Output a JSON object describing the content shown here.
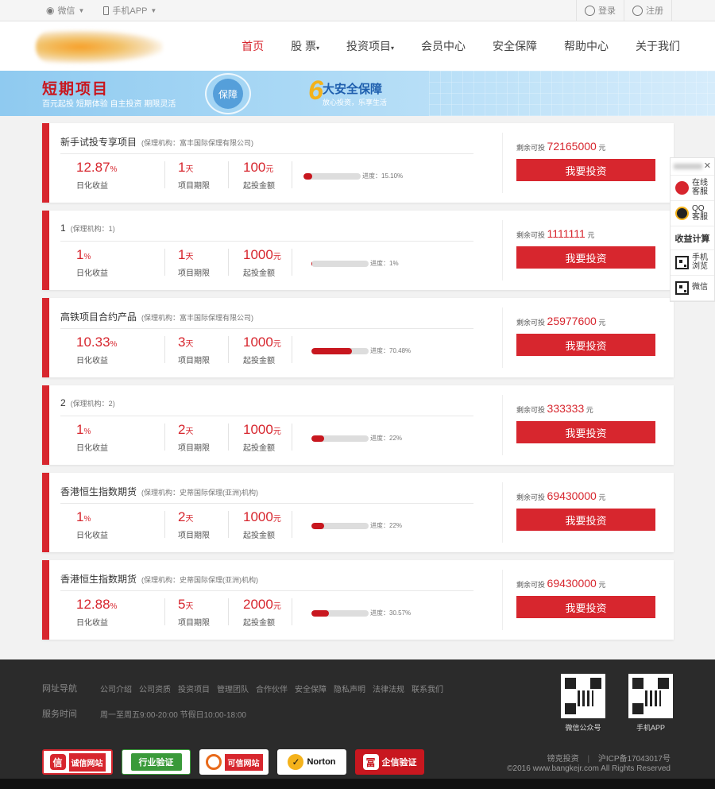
{
  "topbar": {
    "wechat_label": "微信",
    "app_label": "手机APP",
    "login_label": "登录",
    "register_label": "注册"
  },
  "nav": {
    "items": [
      "首页",
      "股 票",
      "投资项目",
      "会员中心",
      "安全保障",
      "帮助中心",
      "关于我们"
    ]
  },
  "banner": {
    "title": "短期项目",
    "subtitle": "百元起投 短期体验 自主投资 期限灵活",
    "shield_label": "保障",
    "six": "6",
    "six_title": "大安全保障",
    "six_sub": "放心投资，乐享生活"
  },
  "labels": {
    "rate": "日化收益",
    "term": "项目期限",
    "min": "起投金额",
    "remain": "剩余可投",
    "yuan": "元",
    "button": "我要投资"
  },
  "products": [
    {
      "name": "新手试投专享项目",
      "org": "(保理机构：富丰国际保理有限公司)",
      "rate": "12.87",
      "rate_unit": "%",
      "term": "1",
      "term_unit": "天",
      "min": "100",
      "min_unit": "元",
      "progress_text": "进度：15.10%",
      "progress": 15.1,
      "remain": "72165000"
    },
    {
      "name": "1",
      "org": "(保理机构：1)",
      "rate": "1",
      "rate_unit": "%",
      "term": "1",
      "term_unit": "天",
      "min": "1000",
      "min_unit": "元",
      "progress_text": "进度：1%",
      "progress": 1,
      "remain": "1111111"
    },
    {
      "name": "高铁项目合约产品",
      "org": "(保理机构：富丰国际保理有限公司)",
      "rate": "10.33",
      "rate_unit": "%",
      "term": "3",
      "term_unit": "天",
      "min": "1000",
      "min_unit": "元",
      "progress_text": "进度：70.48%",
      "progress": 70.48,
      "remain": "25977600"
    },
    {
      "name": "2",
      "org": "(保理机构：2)",
      "rate": "1",
      "rate_unit": "%",
      "term": "2",
      "term_unit": "天",
      "min": "1000",
      "min_unit": "元",
      "progress_text": "进度：22%",
      "progress": 22,
      "remain": "333333"
    },
    {
      "name": "香港恒生指数期货",
      "org": "(保理机构：史蒂国际保理(亚洲)机构)",
      "rate": "1",
      "rate_unit": "%",
      "term": "2",
      "term_unit": "天",
      "min": "1000",
      "min_unit": "元",
      "progress_text": "进度：22%",
      "progress": 22,
      "remain": "69430000"
    },
    {
      "name": "香港恒生指数期货",
      "org": "(保理机构：史蒂国际保理(亚洲)机构)",
      "rate": "12.88",
      "rate_unit": "%",
      "term": "5",
      "term_unit": "天",
      "min": "2000",
      "min_unit": "元",
      "progress_text": "进度：30.57%",
      "progress": 30.57,
      "remain": "69430000"
    }
  ],
  "sidebar": {
    "online_label": "在线客服",
    "qq_label": "QQ客服",
    "calc_label": "收益计算",
    "mobile_label": "手机浏览",
    "wechat_label": "微信"
  },
  "footer": {
    "nav_label": "网址导航",
    "links": [
      "公司介绍",
      "公司资质",
      "投资项目",
      "管理团队",
      "合作伙伴",
      "安全保障",
      "隐私声明",
      "法律法规",
      "联系我们"
    ],
    "service_label": "服务时间",
    "service_time": "周一至周五9:00-20:00 节假日10:00-18:00",
    "qr1_caption": "微信公众号",
    "qr2_caption": "手机APP",
    "badges": [
      "诚信网站",
      "行业验证",
      "可信网站",
      "Norton",
      "企信验证"
    ],
    "company": "镑克投资",
    "icp": "沪ICP备17043017号",
    "copyright": "©2016 www.bangkejr.com All Rights Reserved"
  },
  "colors": {
    "accent": "#d7262e",
    "footer_bg": "#2b2b2b",
    "banner_bg": "#a9d8f5"
  }
}
